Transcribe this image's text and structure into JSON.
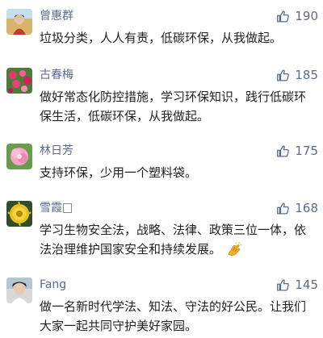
{
  "comments": [
    {
      "name": "曾惠群",
      "likes": "190",
      "text": "垃圾分类，人人有责，低碳环保，从我做起。",
      "avatar": "avatar-photo"
    },
    {
      "name": "古春梅",
      "likes": "185",
      "text": "做好常态化防控措施，学习环保知识，践行低碳环保生活，低碳环保，从我做起。",
      "avatar": "avatar-photo"
    },
    {
      "name": "林日芳",
      "likes": "175",
      "text": "支持环保，少用一个塑料袋。",
      "avatar": "avatar-photo"
    },
    {
      "name": "雪霞",
      "likes": "168",
      "text": "学习生物安全法，战略、法律、政策三位一体，依法治理维护国家安全和持续发展。",
      "emoji": "clapping-hands-emoji",
      "avatar": "avatar-photo"
    },
    {
      "name": "Fang",
      "likes": "145",
      "text": "做一名新时代学法、知法、守法的好公民。让我们大家一起共同守护美好家园。",
      "avatar": "avatar-photo"
    }
  ],
  "icons": {
    "like": "thumbs-up-icon"
  },
  "colors": {
    "name": "#5b6b8c",
    "text": "#222222",
    "like_icon": "#5b6b8c"
  }
}
